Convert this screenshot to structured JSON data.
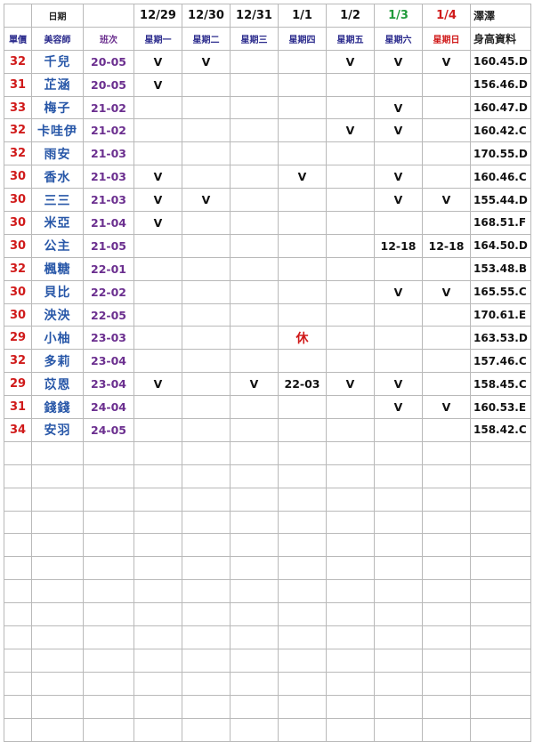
{
  "header": {
    "date_label": "日期",
    "price_label": "單價",
    "stylist_label": "美容師",
    "class_label": "班次",
    "brand": "澤澤",
    "height_label": "身高資料",
    "days": [
      {
        "date": "12/29",
        "weekday": "星期一"
      },
      {
        "date": "12/30",
        "weekday": "星期二"
      },
      {
        "date": "12/31",
        "weekday": "星期三"
      },
      {
        "date": "1/1",
        "weekday": "星期四"
      },
      {
        "date": "1/2",
        "weekday": "星期五"
      },
      {
        "date": "1/3",
        "weekday": "星期六"
      },
      {
        "date": "1/4",
        "weekday": "星期日"
      }
    ]
  },
  "colors": {
    "price": "#d01a1a",
    "name": "#2857a8",
    "class": "#6b2f8f",
    "saturday": "#1f9a3a",
    "sunday": "#d01a1a"
  },
  "rows": [
    {
      "price": "32",
      "name": "千兒",
      "cls": "20-05",
      "days": [
        "V",
        "V",
        "",
        "",
        "V",
        "V",
        "V"
      ],
      "height": "160.45.D"
    },
    {
      "price": "31",
      "name": "芷涵",
      "cls": "20-05",
      "days": [
        "V",
        "",
        "",
        "",
        "",
        "",
        ""
      ],
      "height": "156.46.D"
    },
    {
      "price": "33",
      "name": "梅子",
      "cls": "21-02",
      "days": [
        "",
        "",
        "",
        "",
        "",
        "V",
        ""
      ],
      "height": "160.47.D"
    },
    {
      "price": "32",
      "name": "卡哇伊",
      "cls": "21-02",
      "days": [
        "",
        "",
        "",
        "",
        "V",
        "V",
        ""
      ],
      "height": "160.42.C"
    },
    {
      "price": "32",
      "name": "雨安",
      "cls": "21-03",
      "days": [
        "",
        "",
        "",
        "",
        "",
        "",
        ""
      ],
      "height": "170.55.D"
    },
    {
      "price": "30",
      "name": "香水",
      "cls": "21-03",
      "days": [
        "V",
        "",
        "",
        "V",
        "",
        "V",
        ""
      ],
      "height": "160.46.C"
    },
    {
      "price": "30",
      "name": "三三",
      "cls": "21-03",
      "days": [
        "V",
        "V",
        "",
        "",
        "",
        "V",
        "V"
      ],
      "height": "155.44.D"
    },
    {
      "price": "30",
      "name": "米亞",
      "cls": "21-04",
      "days": [
        "V",
        "",
        "",
        "",
        "",
        "",
        ""
      ],
      "height": "168.51.F"
    },
    {
      "price": "30",
      "name": "公主",
      "cls": "21-05",
      "days": [
        "",
        "",
        "",
        "",
        "",
        "12-18",
        "12-18"
      ],
      "height": "164.50.D"
    },
    {
      "price": "32",
      "name": "楓糖",
      "cls": "22-01",
      "days": [
        "",
        "",
        "",
        "",
        "",
        "",
        ""
      ],
      "height": "153.48.B"
    },
    {
      "price": "30",
      "name": "貝比",
      "cls": "22-02",
      "days": [
        "",
        "",
        "",
        "",
        "",
        "V",
        "V"
      ],
      "height": "165.55.C"
    },
    {
      "price": "30",
      "name": "泱泱",
      "cls": "22-05",
      "days": [
        "",
        "",
        "",
        "",
        "",
        "",
        ""
      ],
      "height": "170.61.E"
    },
    {
      "price": "29",
      "name": "小柚",
      "cls": "23-03",
      "days": [
        "",
        "",
        "",
        "休",
        "",
        "",
        ""
      ],
      "height": "163.53.D"
    },
    {
      "price": "32",
      "name": "多莉",
      "cls": "23-04",
      "days": [
        "",
        "",
        "",
        "",
        "",
        "",
        ""
      ],
      "height": "157.46.C"
    },
    {
      "price": "29",
      "name": "苡恩",
      "cls": "23-04",
      "days": [
        "V",
        "",
        "V",
        "22-03",
        "V",
        "V",
        ""
      ],
      "height": "158.45.C"
    },
    {
      "price": "31",
      "name": "錢錢",
      "cls": "24-04",
      "days": [
        "",
        "",
        "",
        "",
        "",
        "V",
        "V"
      ],
      "height": "160.53.E"
    },
    {
      "price": "34",
      "name": "安羽",
      "cls": "24-05",
      "days": [
        "",
        "",
        "",
        "",
        "",
        "",
        ""
      ],
      "height": "158.42.C"
    }
  ],
  "empty_rows": 13
}
